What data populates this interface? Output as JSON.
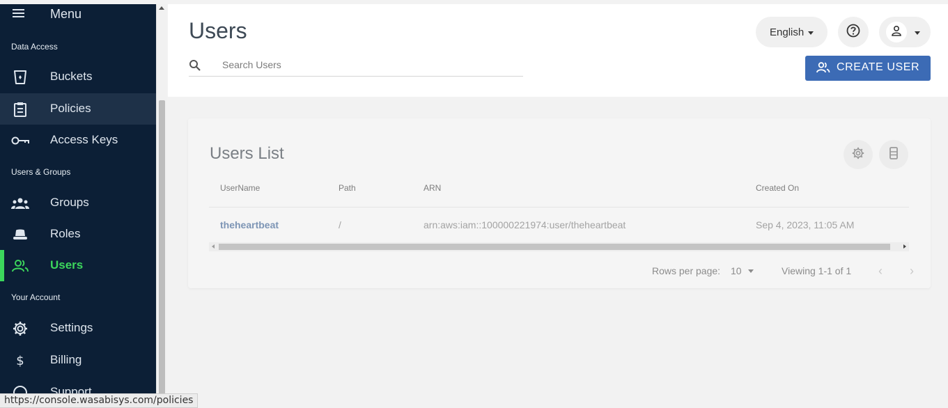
{
  "sidebar": {
    "menu_label": "Menu",
    "sections": {
      "data_access": "Data Access",
      "users_groups": "Users & Groups",
      "your_account": "Your Account"
    },
    "items": [
      {
        "label": "Buckets",
        "icon": "bucket-icon"
      },
      {
        "label": "Policies",
        "icon": "clipboard-icon"
      },
      {
        "label": "Access Keys",
        "icon": "key-icon"
      },
      {
        "label": "Groups",
        "icon": "groups-icon"
      },
      {
        "label": "Roles",
        "icon": "hat-icon"
      },
      {
        "label": "Users",
        "icon": "users-icon",
        "active": true
      },
      {
        "label": "Settings",
        "icon": "gear-icon"
      },
      {
        "label": "Billing",
        "icon": "dollar-icon"
      },
      {
        "label": "Support",
        "icon": "help-circle-icon"
      }
    ],
    "accent_color": "#3cd65c",
    "background_color": "#0c1f36"
  },
  "header": {
    "title": "Users",
    "search_placeholder": "Search Users",
    "language": "English",
    "create_button_label": "CREATE USER",
    "button_color": "#3c6bb5"
  },
  "users_list": {
    "title": "Users List",
    "columns": [
      "UserName",
      "Path",
      "ARN",
      "Created On"
    ],
    "rows": [
      {
        "username": "theheartbeat",
        "path": "/",
        "arn": "arn:aws:iam::100000221974:user/theheartbeat",
        "created_on": "Sep 4, 2023, 11:05 AM"
      }
    ],
    "pagination": {
      "rows_per_page_label": "Rows per page:",
      "rows_per_page": "10",
      "viewing": "Viewing 1-1 of 1"
    }
  },
  "status_bar": {
    "url": "https://console.wasabisys.com/policies"
  }
}
